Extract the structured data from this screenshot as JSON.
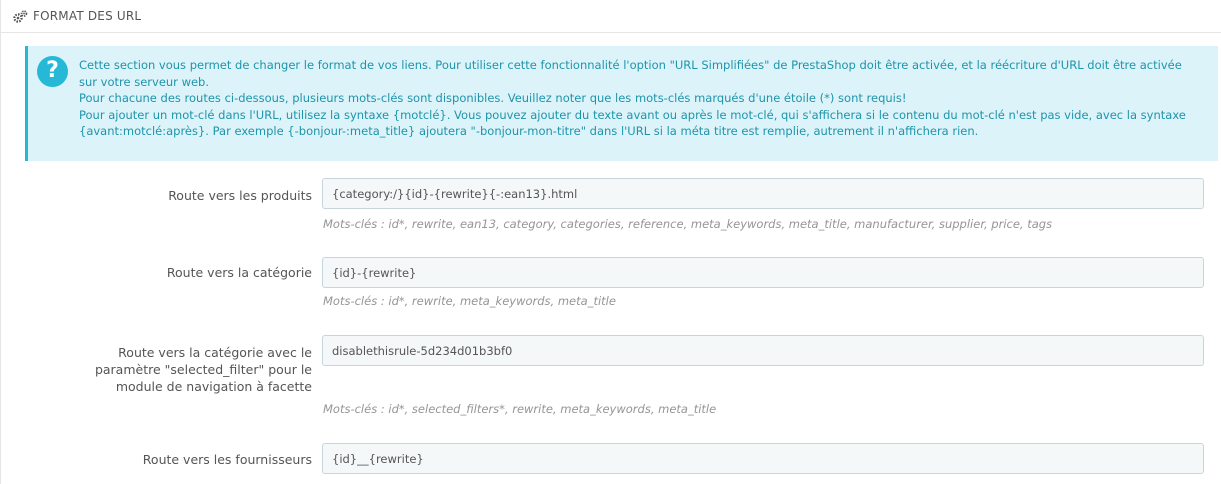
{
  "panel": {
    "title": "FORMAT DES URL",
    "icon": "cogs-icon"
  },
  "alert": {
    "icon": "question-circle-icon",
    "lines": [
      "Cette section vous permet de changer le format de vos liens. Pour utiliser cette fonctionnalité l'option \"URL Simplifiées\" de PrestaShop doit être activée, et la réécriture d'URL doit être activée sur votre serveur web.",
      "Pour chacune des routes ci-dessous, plusieurs mots-clés sont disponibles. Veuillez noter que les mots-clés marqués d'une étoile (*) sont requis!",
      "Pour ajouter un mot-clé dans l'URL, utilisez la syntaxe {motclé}. Vous pouvez ajouter du texte avant ou après le mot-clé, qui s'affichera si le contenu du mot-clé n'est pas vide, avec la syntaxe {avant:motclé:après}. Par exemple {-bonjour-:meta_title} ajoutera \"-bonjour-mon-titre\" dans l'URL si la méta titre est remplie, autrement il n'affichera rien."
    ]
  },
  "routes": [
    {
      "label": "Route vers les produits",
      "value": "{category:/}{id}-{rewrite}{-:ean13}.html",
      "help": "Mots-clés : id*, rewrite, ean13, category, categories, reference, meta_keywords, meta_title, manufacturer, supplier, price, tags"
    },
    {
      "label": "Route vers la catégorie",
      "value": "{id}-{rewrite}",
      "help": "Mots-clés : id*, rewrite, meta_keywords, meta_title"
    },
    {
      "label": "Route vers la catégorie avec le paramètre \"selected_filter\" pour le module de navigation à facette",
      "value": "disablethisrule-5d234d01b3bf0",
      "help": "Mots-clés : id*, selected_filters*, rewrite, meta_keywords, meta_title"
    },
    {
      "label": "Route vers les fournisseurs",
      "value": "{id}__{rewrite}",
      "help": ""
    }
  ]
}
